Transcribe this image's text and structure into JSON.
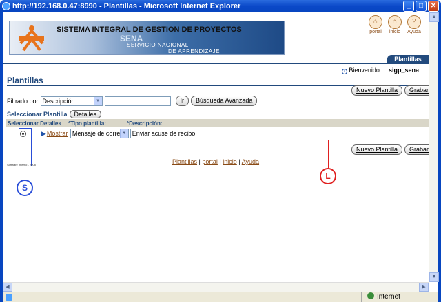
{
  "window": {
    "title": "http://192.168.0.47:8990 - Plantillas - Microsoft Internet Explorer",
    "minimize_icon": "minimize-icon",
    "maximize_icon": "maximize-icon",
    "close_icon": "close-icon"
  },
  "banner": {
    "title": "SISTEMA INTEGRAL DE GESTION DE PROYECTOS",
    "sena": "SENA",
    "servicio": "SERVICIO NACIONAL",
    "aprendizaje": "DE APRENDIZAJE",
    "logo_text": "SENA"
  },
  "top_links": [
    {
      "label": "portal",
      "icon": "home-icon"
    },
    {
      "label": "inicio",
      "icon": "start-icon"
    },
    {
      "label": "Ayuda",
      "icon": "help-icon"
    }
  ],
  "tab": {
    "label": "Plantillas"
  },
  "welcome": {
    "label": "Bienvenido:",
    "user": "sigp_sena"
  },
  "page_title": "Plantillas",
  "buttons": {
    "nuevo": "Nuevo Plantilla",
    "grabar": "Grabar"
  },
  "filter": {
    "label": "Filtrado por",
    "select_value": "Descripción",
    "go_label": "Ir",
    "advanced_label": "Búsqueda Avanzada"
  },
  "grid": {
    "title": "Seleccionar Plantilla",
    "detalles_button": "Detalles",
    "columns": [
      "Seleccionar Detalles",
      "*Tipo plantilla:",
      "*Descripción:"
    ],
    "rows": [
      {
        "mostrar": "Mostrar",
        "tipo": "Mensaje de correo",
        "descripcion": "Enviar acuse de recibo"
      }
    ]
  },
  "footer": {
    "links": [
      "Plantillas",
      "portal",
      "inicio",
      "Ayuda"
    ],
    "separator": "|",
    "copyright": "Software Interno - 2008"
  },
  "callouts": {
    "s": "S",
    "l": "L"
  },
  "status": {
    "zone": "Internet"
  }
}
